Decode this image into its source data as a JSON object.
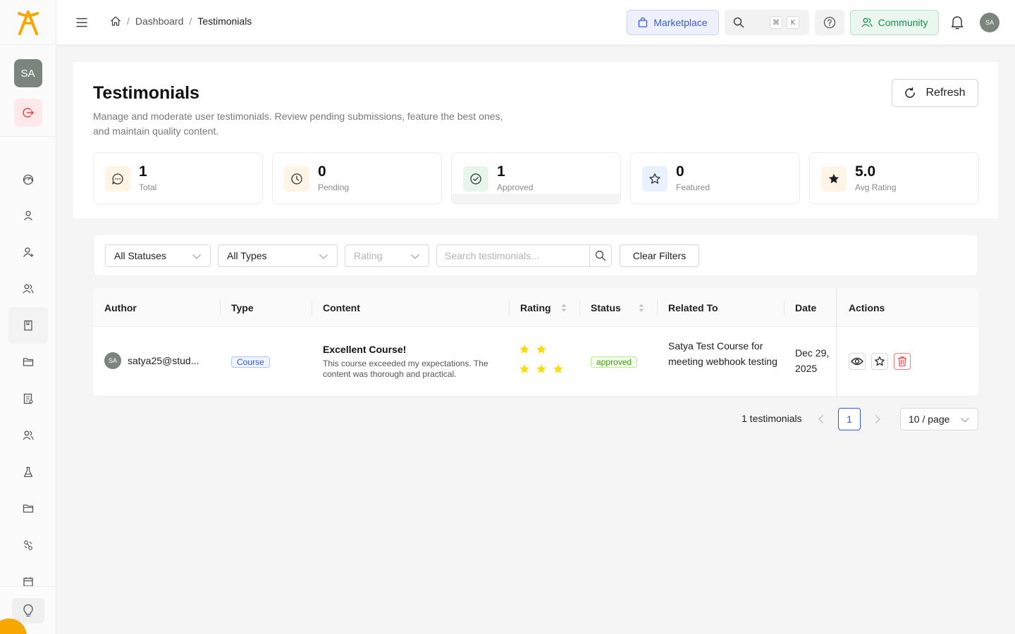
{
  "colors": {
    "brand": "#f7a800",
    "accent": "#2f54eb",
    "success": "#389e0d",
    "danger": "#ff4d4f",
    "star": "#fadb14"
  },
  "sidebar": {
    "avatar_initials": "SA",
    "icons": [
      "dashboard-icon",
      "user-icon",
      "user-add-icon",
      "users-icon",
      "book-icon",
      "folder-icon",
      "report-icon",
      "team-icon",
      "flask-icon",
      "folder-icon",
      "connections-icon",
      "calendar-icon"
    ],
    "bottom_icon": "bulb-icon"
  },
  "header": {
    "breadcrumb": {
      "home_icon": "home-icon",
      "items": [
        "Dashboard",
        "Testimonials"
      ]
    },
    "marketplace_label": "Marketplace",
    "search_shortcut": [
      "⌘",
      "K"
    ],
    "community_label": "Community",
    "avatar_initials": "SA"
  },
  "page": {
    "title": "Testimonials",
    "description": "Manage and moderate user testimonials. Review pending submissions, feature the best ones, and maintain quality content.",
    "refresh_label": "Refresh"
  },
  "stats": [
    {
      "value": "1",
      "label": "Total",
      "icon": "message-icon",
      "bg": "#fff5e6",
      "color": "#333333"
    },
    {
      "value": "0",
      "label": "Pending",
      "icon": "clock-icon",
      "bg": "#fff5e6",
      "color": "#333333"
    },
    {
      "value": "1",
      "label": "Approved",
      "icon": "check-circle-icon",
      "bg": "#e8f5ec",
      "color": "#333333"
    },
    {
      "value": "0",
      "label": "Featured",
      "icon": "star-outline-icon",
      "bg": "#e8f1fd",
      "color": "#333333"
    },
    {
      "value": "5.0",
      "label": "Avg Rating",
      "icon": "star-filled-icon",
      "bg": "#fff5e6",
      "color": "#1f1f1f"
    }
  ],
  "filters": {
    "status": "All Statuses",
    "type": "All Types",
    "rating_placeholder": "Rating",
    "search_placeholder": "Search testimonials...",
    "clear_label": "Clear Filters"
  },
  "table": {
    "columns": [
      "Author",
      "Type",
      "Content",
      "Rating",
      "Status",
      "Related To",
      "Date",
      "Actions"
    ],
    "rows": [
      {
        "author_initials": "SA",
        "author": "satya25@stud...",
        "type": "Course",
        "content_title": "Excellent Course!",
        "content_body": "This course exceeded my expectations. The content was thorough and practical.",
        "rating": 5,
        "status": "approved",
        "related_to": "Satya Test Course for meeting webhook testing",
        "date": "Dec 29, 2025"
      }
    ]
  },
  "pagination": {
    "total_label": "1 testimonials",
    "current_page": "1",
    "page_size": "10 / page"
  }
}
